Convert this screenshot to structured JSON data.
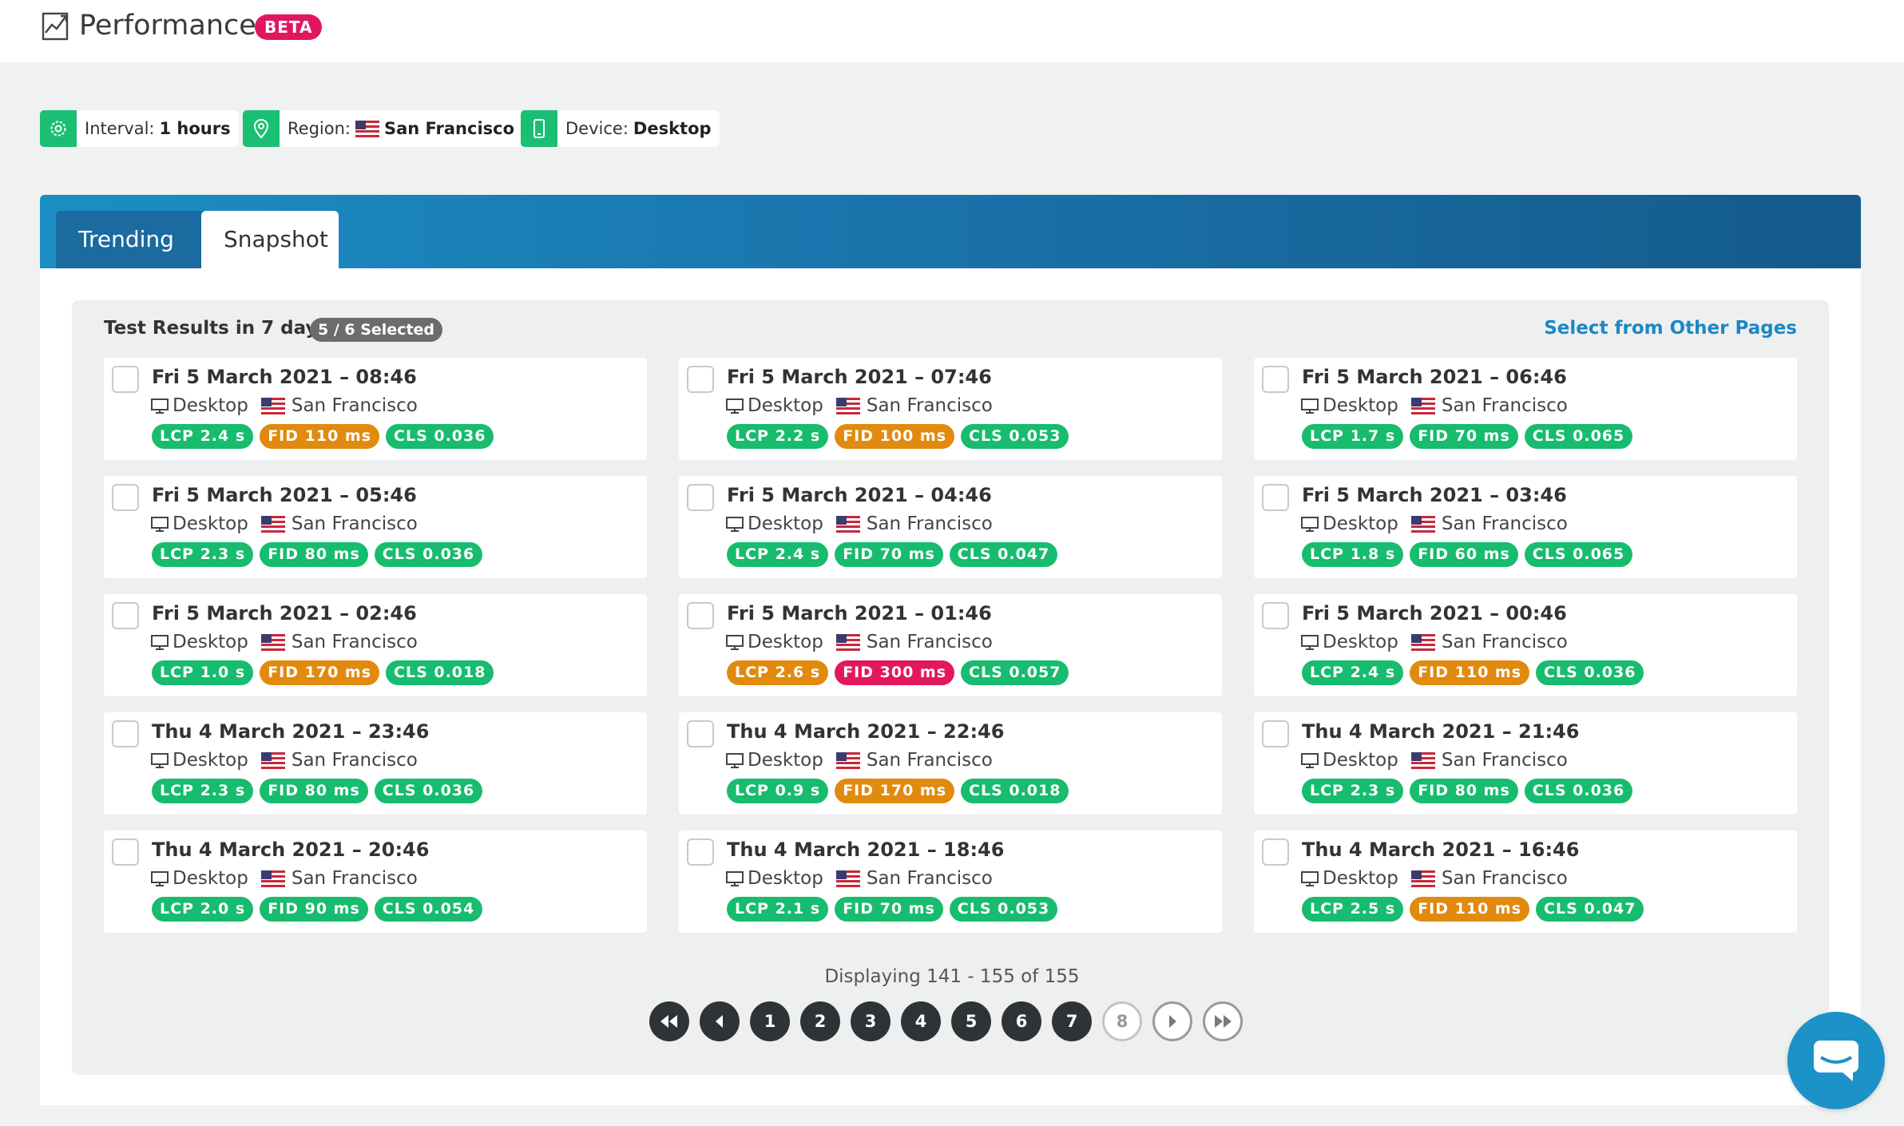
{
  "header": {
    "title": "Performance",
    "badge": "BETA",
    "title_icon": "chart-line-icon"
  },
  "filters": [
    {
      "key": "interval",
      "label": "Interval:",
      "value": "1 hours",
      "icon": "gear-icon"
    },
    {
      "key": "region",
      "label": "Region:",
      "value": "San Francisco",
      "icon": "location-pin-icon",
      "flag": "us-flag-icon"
    },
    {
      "key": "device",
      "label": "Device:",
      "value": "Desktop",
      "icon": "mobile-device-icon"
    }
  ],
  "tabs": [
    {
      "label": "Trending",
      "active": false
    },
    {
      "label": "Snapshot",
      "active": true
    }
  ],
  "results": {
    "title": "Test Results in 7 days",
    "selected": "5 / 6 Selected",
    "select_other": "Select from Other Pages"
  },
  "cards": [
    {
      "title": "Fri 5 March 2021 – 08:46",
      "device": "Desktop",
      "region": "San Francisco",
      "lcp": "LCP 2.4 s",
      "lcp_status": "good",
      "fid": "FID 110 ms",
      "fid_status": "warn",
      "cls": "CLS 0.036",
      "cls_status": "good"
    },
    {
      "title": "Fri 5 March 2021 – 07:46",
      "device": "Desktop",
      "region": "San Francisco",
      "lcp": "LCP 2.2 s",
      "lcp_status": "good",
      "fid": "FID 100 ms",
      "fid_status": "warn",
      "cls": "CLS 0.053",
      "cls_status": "good"
    },
    {
      "title": "Fri 5 March 2021 – 06:46",
      "device": "Desktop",
      "region": "San Francisco",
      "lcp": "LCP 1.7 s",
      "lcp_status": "good",
      "fid": "FID 70 ms",
      "fid_status": "good",
      "cls": "CLS 0.065",
      "cls_status": "good"
    },
    {
      "title": "Fri 5 March 2021 – 05:46",
      "device": "Desktop",
      "region": "San Francisco",
      "lcp": "LCP 2.3 s",
      "lcp_status": "good",
      "fid": "FID 80 ms",
      "fid_status": "good",
      "cls": "CLS 0.036",
      "cls_status": "good"
    },
    {
      "title": "Fri 5 March 2021 – 04:46",
      "device": "Desktop",
      "region": "San Francisco",
      "lcp": "LCP 2.4 s",
      "lcp_status": "good",
      "fid": "FID 70 ms",
      "fid_status": "good",
      "cls": "CLS 0.047",
      "cls_status": "good"
    },
    {
      "title": "Fri 5 March 2021 – 03:46",
      "device": "Desktop",
      "region": "San Francisco",
      "lcp": "LCP 1.8 s",
      "lcp_status": "good",
      "fid": "FID 60 ms",
      "fid_status": "good",
      "cls": "CLS 0.065",
      "cls_status": "good"
    },
    {
      "title": "Fri 5 March 2021 – 02:46",
      "device": "Desktop",
      "region": "San Francisco",
      "lcp": "LCP 1.0 s",
      "lcp_status": "good",
      "fid": "FID 170 ms",
      "fid_status": "warn",
      "cls": "CLS 0.018",
      "cls_status": "good"
    },
    {
      "title": "Fri 5 March 2021 – 01:46",
      "device": "Desktop",
      "region": "San Francisco",
      "lcp": "LCP 2.6 s",
      "lcp_status": "warn",
      "fid": "FID 300 ms",
      "fid_status": "bad",
      "cls": "CLS 0.057",
      "cls_status": "good"
    },
    {
      "title": "Fri 5 March 2021 – 00:46",
      "device": "Desktop",
      "region": "San Francisco",
      "lcp": "LCP 2.4 s",
      "lcp_status": "good",
      "fid": "FID 110 ms",
      "fid_status": "warn",
      "cls": "CLS 0.036",
      "cls_status": "good"
    },
    {
      "title": "Thu 4 March 2021 – 23:46",
      "device": "Desktop",
      "region": "San Francisco",
      "lcp": "LCP 2.3 s",
      "lcp_status": "good",
      "fid": "FID 80 ms",
      "fid_status": "good",
      "cls": "CLS 0.036",
      "cls_status": "good"
    },
    {
      "title": "Thu 4 March 2021 – 22:46",
      "device": "Desktop",
      "region": "San Francisco",
      "lcp": "LCP 0.9 s",
      "lcp_status": "good",
      "fid": "FID 170 ms",
      "fid_status": "warn",
      "cls": "CLS 0.018",
      "cls_status": "good"
    },
    {
      "title": "Thu 4 March 2021 – 21:46",
      "device": "Desktop",
      "region": "San Francisco",
      "lcp": "LCP 2.3 s",
      "lcp_status": "good",
      "fid": "FID 80 ms",
      "fid_status": "good",
      "cls": "CLS 0.036",
      "cls_status": "good"
    },
    {
      "title": "Thu 4 March 2021 – 20:46",
      "device": "Desktop",
      "region": "San Francisco",
      "lcp": "LCP 2.0 s",
      "lcp_status": "good",
      "fid": "FID 90 ms",
      "fid_status": "good",
      "cls": "CLS 0.054",
      "cls_status": "good"
    },
    {
      "title": "Thu 4 March 2021 – 18:46",
      "device": "Desktop",
      "region": "San Francisco",
      "lcp": "LCP 2.1 s",
      "lcp_status": "good",
      "fid": "FID 70 ms",
      "fid_status": "good",
      "cls": "CLS 0.053",
      "cls_status": "good"
    },
    {
      "title": "Thu 4 March 2021 – 16:46",
      "device": "Desktop",
      "region": "San Francisco",
      "lcp": "LCP 2.5 s",
      "lcp_status": "good",
      "fid": "FID 110 ms",
      "fid_status": "warn",
      "cls": "CLS 0.047",
      "cls_status": "good"
    }
  ],
  "pagination": {
    "displaying": "Displaying 141 - 155 of 155",
    "first_icon": "first-page-icon",
    "prev_icon": "prev-page-icon",
    "pages": [
      "1",
      "2",
      "3",
      "4",
      "5",
      "6",
      "7",
      "8"
    ],
    "current_page": "8",
    "next_icon": "next-page-icon",
    "last_icon": "last-page-icon"
  },
  "chat": {
    "icon": "chat-bubble-icon"
  },
  "colors": {
    "good": "#17bc6e",
    "warn": "#e28a0e",
    "bad": "#e2185e",
    "accent": "#1a88c5",
    "filter_icon_bg": "#1bbf73"
  }
}
